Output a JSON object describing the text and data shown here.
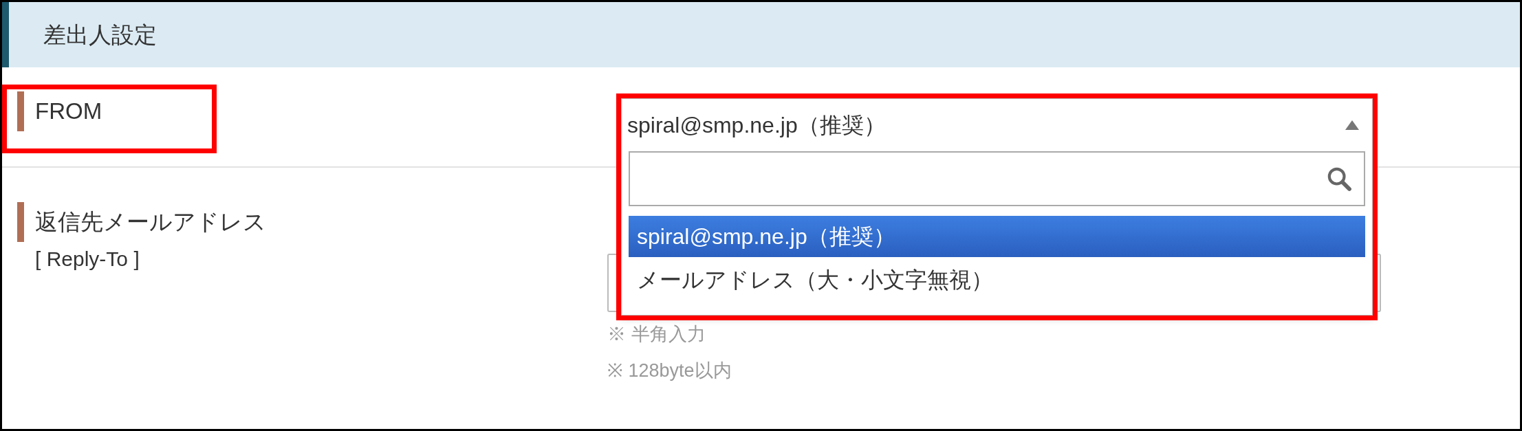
{
  "section": {
    "title": "差出人設定"
  },
  "fields": [
    {
      "label": "FROM",
      "highlighted": true
    },
    {
      "label": "返信先メールアドレス",
      "sublabel": "[ Reply-To ]",
      "hints": [
        "※ 半角入力",
        "※ 128byte以内"
      ]
    }
  ],
  "dropdown": {
    "value": "spiral@smp.ne.jp（推奨）",
    "expanded": true,
    "highlighted": true,
    "options": [
      {
        "label": "spiral@smp.ne.jp（推奨）",
        "selected": true
      },
      {
        "label": "メールアドレス（大・小文字無視）",
        "selected": false
      }
    ]
  }
}
